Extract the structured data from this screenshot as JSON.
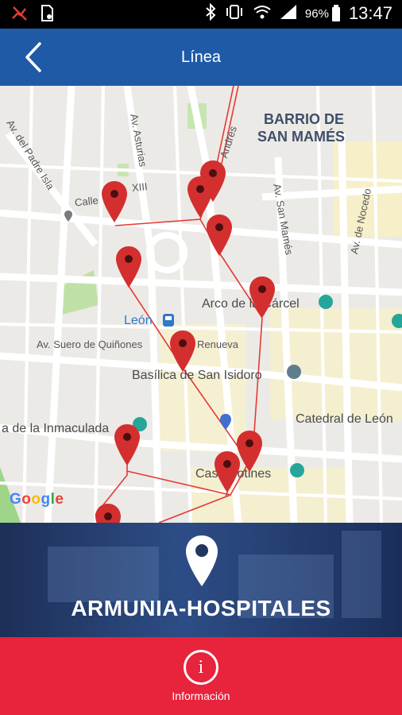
{
  "status_bar": {
    "battery": "96%",
    "time": "13:47"
  },
  "header": {
    "title": "Línea"
  },
  "map": {
    "labels": {
      "barrio_line1": "BARRIO DE",
      "barrio_line2": "SAN MAMÉS",
      "av_padre_isla": "Av. del Padre Isla",
      "av_asturias": "Av. Asturias",
      "calle_xiii": "Calle",
      "calle_xiii_b": "XIII",
      "andres": "Andrés",
      "av_san_mames": "Av. San Mamés",
      "av_nocedo": "Av. de Nocedo",
      "arco_carcel": "Arco de la Cárcel",
      "leon": "León",
      "suero": "Av. Suero de Quiñones",
      "renueva": "Renueva",
      "basilica": "Basílica de San Isidoro",
      "catedral": "Catedral de León",
      "inmaculada": "a de la Inmaculada",
      "casa_botines": "Casa Botines"
    },
    "google": [
      "G",
      "o",
      "o",
      "g",
      "l",
      "e"
    ]
  },
  "route": {
    "name": "ARMUNIA-HOSPITALES"
  },
  "info_button": {
    "label": "Información"
  },
  "colors": {
    "header": "#1f5aa6",
    "info": "#e8233c",
    "marker": "#d32f2f",
    "route": "#e53935"
  }
}
